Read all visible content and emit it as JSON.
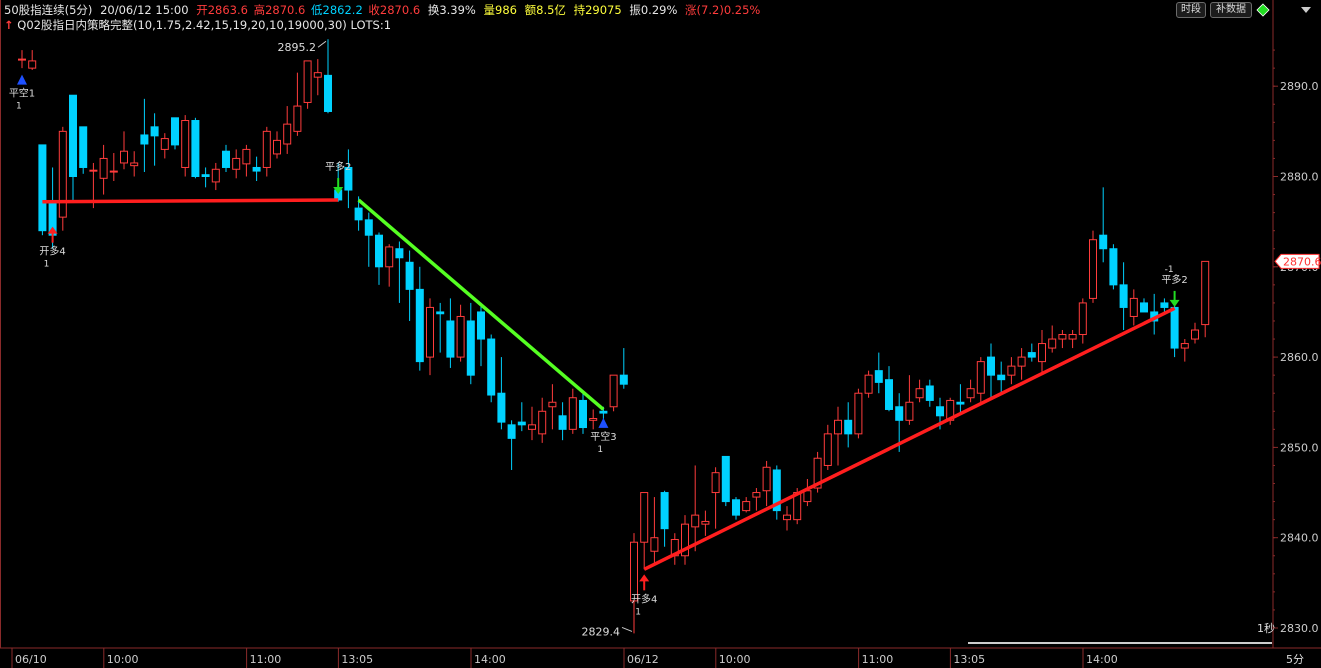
{
  "header": {
    "symbol": "50股指连续(5分)",
    "datetime": "20/06/12 15:00",
    "open_label": "开",
    "open_value": "2863.6",
    "high_label": "高",
    "high_value": "2870.6",
    "low_label": "低",
    "low_value": "2862.2",
    "close_label": "收",
    "close_value": "2870.6",
    "turnover_label": "换",
    "turnover_value": "3.39%",
    "volume_label": "量",
    "volume_value": "986",
    "amount_label": "额",
    "amount_value": "8.5亿",
    "oi_label": "持",
    "oi_value": "29075",
    "amplitude_label": "振",
    "amplitude_value": "0.29%",
    "change_label": "涨",
    "change_value": "(7.2)",
    "change_pct": "0.25%"
  },
  "strategy": {
    "arrow": "↑",
    "text": "Q02股指日内策略完整(10,1.75,2.42,15,19,20,10,19000,30) LOTS:1"
  },
  "toolbar": {
    "timeshare_label": "时段",
    "supplement_label": "补数据"
  },
  "icons": {
    "up": "triangle-up-icon",
    "down": "triangle-down-icon",
    "diamond": "diamond-icon",
    "up_arrow": "red-up-arrow-icon",
    "down_arrow": "green-down-arrow-icon"
  },
  "colors": {
    "up": "#ff3c3c",
    "down": "#00d2ff",
    "signal_red": "#ff1e1e",
    "signal_green": "#55ff22",
    "grid": "#8a2a2a",
    "axis_text": "#cccccc"
  },
  "chart_data": {
    "type": "candlestick",
    "ylim": [
      2828,
      2897
    ],
    "y_ticks": [
      2830.0,
      2840.0,
      2850.0,
      2860.0,
      2870.0,
      2880.0,
      2890.0
    ],
    "x_tick_labels": [
      "06/10",
      "10:00",
      "11:00",
      "13:05",
      "14:00",
      "06/12",
      "10:00",
      "11:00",
      "13:05",
      "14:00"
    ],
    "x_tick_index": [
      0,
      9,
      23,
      32,
      45,
      60,
      69,
      83,
      92,
      105
    ],
    "current_price": "2870.6",
    "timeframe": "5分",
    "speed": "1秒",
    "max_label": "2895.2",
    "min_label": "2829.4",
    "candles": [
      [
        2893.0,
        2894.0,
        2892.0,
        2893.0
      ],
      [
        2892.0,
        2894.0,
        2891.8,
        2892.8
      ],
      [
        2883.5,
        2883.5,
        2873.5,
        2874.0
      ],
      [
        2877.2,
        2881.0,
        2872.0,
        2873.5
      ],
      [
        2875.5,
        2885.5,
        2874.0,
        2885.0
      ],
      [
        2889.0,
        2889.0,
        2877.2,
        2880.0
      ],
      [
        2885.5,
        2885.5,
        2880.3,
        2881.0
      ],
      [
        2880.6,
        2881.5,
        2876.5,
        2880.7
      ],
      [
        2879.8,
        2883.5,
        2878.0,
        2882.0
      ],
      [
        2880.5,
        2882.6,
        2879.5,
        2880.6
      ],
      [
        2881.5,
        2885.0,
        2880.8,
        2882.8
      ],
      [
        2881.2,
        2882.8,
        2880.0,
        2881.5
      ],
      [
        2884.6,
        2888.6,
        2880.5,
        2883.6
      ],
      [
        2885.5,
        2887.0,
        2881.2,
        2884.5
      ],
      [
        2883.0,
        2884.8,
        2882.0,
        2884.2
      ],
      [
        2886.5,
        2886.5,
        2883.0,
        2883.5
      ],
      [
        2881.0,
        2886.8,
        2880.0,
        2886.2
      ],
      [
        2886.2,
        2886.5,
        2879.8,
        2880.0
      ],
      [
        2880.2,
        2881.0,
        2878.8,
        2880.0
      ],
      [
        2879.4,
        2881.5,
        2878.5,
        2880.8
      ],
      [
        2882.8,
        2883.5,
        2880.5,
        2881.0
      ],
      [
        2880.8,
        2883.0,
        2879.8,
        2882.0
      ],
      [
        2881.4,
        2883.5,
        2880.0,
        2883.0
      ],
      [
        2881.0,
        2882.2,
        2879.5,
        2880.6
      ],
      [
        2881.0,
        2885.5,
        2880.0,
        2885.0
      ],
      [
        2882.5,
        2885.0,
        2882.0,
        2884.0
      ],
      [
        2883.6,
        2887.8,
        2882.5,
        2885.8
      ],
      [
        2885.0,
        2891.5,
        2884.5,
        2887.8
      ],
      [
        2888.2,
        2892.8,
        2887.5,
        2892.8
      ],
      [
        2891.0,
        2893.0,
        2889.0,
        2891.5
      ],
      [
        2891.2,
        2895.2,
        2887.0,
        2887.2
      ],
      [
        2878.5,
        2881.5,
        2877.2,
        2877.4
      ],
      [
        2881.0,
        2883.0,
        2876.5,
        2878.5
      ],
      [
        2876.5,
        2877.8,
        2874.0,
        2875.2
      ],
      [
        2875.2,
        2876.0,
        2870.0,
        2873.5
      ],
      [
        2873.5,
        2873.8,
        2868.0,
        2870.0
      ],
      [
        2870.0,
        2872.5,
        2867.8,
        2872.2
      ],
      [
        2872.0,
        2872.8,
        2866.0,
        2871.0
      ],
      [
        2870.5,
        2871.8,
        2864.0,
        2867.5
      ],
      [
        2867.5,
        2870.0,
        2858.5,
        2859.5
      ],
      [
        2860.0,
        2866.5,
        2858.0,
        2865.5
      ],
      [
        2865.0,
        2866.0,
        2860.5,
        2864.8
      ],
      [
        2864.0,
        2866.5,
        2858.8,
        2860.0
      ],
      [
        2860.0,
        2865.8,
        2859.5,
        2864.5
      ],
      [
        2864.0,
        2866.0,
        2857.0,
        2858.0
      ],
      [
        2865.0,
        2866.0,
        2859.0,
        2862.0
      ],
      [
        2862.0,
        2862.5,
        2855.0,
        2855.8
      ],
      [
        2856.0,
        2860.0,
        2852.0,
        2852.8
      ],
      [
        2852.5,
        2853.0,
        2847.5,
        2851.0
      ],
      [
        2852.8,
        2855.0,
        2851.8,
        2852.5
      ],
      [
        2852.0,
        2854.5,
        2850.8,
        2852.5
      ],
      [
        2851.5,
        2855.5,
        2850.5,
        2854.0
      ],
      [
        2854.5,
        2857.0,
        2852.0,
        2855.0
      ],
      [
        2853.5,
        2855.0,
        2850.8,
        2852.0
      ],
      [
        2852.0,
        2856.5,
        2851.5,
        2855.5
      ],
      [
        2855.2,
        2856.0,
        2851.5,
        2852.2
      ],
      [
        2853.0,
        2854.2,
        2852.0,
        2853.2
      ],
      [
        2854.0,
        2854.5,
        2852.5,
        2853.8
      ],
      [
        2854.5,
        2858.0,
        2854.0,
        2858.0
      ],
      [
        2858.0,
        2861.0,
        2856.5,
        2857.0
      ],
      [
        2833.0,
        2840.5,
        2829.4,
        2839.5
      ],
      [
        2839.5,
        2845.0,
        2836.5,
        2845.0
      ],
      [
        2838.5,
        2844.5,
        2837.0,
        2840.0
      ],
      [
        2845.0,
        2845.2,
        2839.0,
        2841.0
      ],
      [
        2838.0,
        2840.5,
        2837.0,
        2839.8
      ],
      [
        2838.0,
        2842.5,
        2837.0,
        2841.5
      ],
      [
        2841.2,
        2848.0,
        2838.5,
        2842.5
      ],
      [
        2841.5,
        2843.0,
        2840.2,
        2841.8
      ],
      [
        2845.0,
        2847.8,
        2841.0,
        2847.2
      ],
      [
        2849.0,
        2849.0,
        2843.5,
        2844.0
      ],
      [
        2844.2,
        2844.5,
        2842.0,
        2842.5
      ],
      [
        2843.0,
        2844.5,
        2842.8,
        2844.0
      ],
      [
        2844.5,
        2845.5,
        2843.0,
        2845.0
      ],
      [
        2845.2,
        2848.5,
        2843.5,
        2847.8
      ],
      [
        2847.5,
        2848.0,
        2842.0,
        2843.0
      ],
      [
        2842.0,
        2843.5,
        2840.8,
        2842.5
      ],
      [
        2842.0,
        2845.5,
        2841.5,
        2845.0
      ],
      [
        2844.0,
        2846.5,
        2843.5,
        2845.2
      ],
      [
        2845.5,
        2849.5,
        2845.0,
        2848.8
      ],
      [
        2848.0,
        2852.5,
        2847.5,
        2851.5
      ],
      [
        2851.5,
        2854.5,
        2848.0,
        2853.0
      ],
      [
        2853.0,
        2855.0,
        2850.0,
        2851.5
      ],
      [
        2851.5,
        2856.5,
        2851.0,
        2856.0
      ],
      [
        2856.0,
        2858.5,
        2855.5,
        2858.0
      ],
      [
        2858.5,
        2860.5,
        2856.0,
        2857.2
      ],
      [
        2857.5,
        2859.0,
        2854.0,
        2854.2
      ],
      [
        2854.5,
        2856.0,
        2849.5,
        2853.0
      ],
      [
        2853.0,
        2858.0,
        2852.5,
        2855.0
      ],
      [
        2855.5,
        2857.5,
        2855.0,
        2856.5
      ],
      [
        2856.8,
        2857.5,
        2854.5,
        2855.2
      ],
      [
        2854.5,
        2855.5,
        2852.0,
        2853.5
      ],
      [
        2853.0,
        2855.5,
        2852.5,
        2855.2
      ],
      [
        2855.0,
        2857.0,
        2853.8,
        2854.8
      ],
      [
        2855.5,
        2857.5,
        2855.0,
        2856.5
      ],
      [
        2856.0,
        2860.0,
        2855.0,
        2859.5
      ],
      [
        2860.0,
        2861.5,
        2855.5,
        2858.0
      ],
      [
        2858.0,
        2859.5,
        2856.0,
        2857.5
      ],
      [
        2858.0,
        2860.0,
        2857.0,
        2859.0
      ],
      [
        2859.0,
        2861.0,
        2857.5,
        2860.0
      ],
      [
        2860.5,
        2861.5,
        2859.5,
        2860.0
      ],
      [
        2859.5,
        2863.0,
        2858.0,
        2861.5
      ],
      [
        2861.0,
        2863.5,
        2860.5,
        2862.0
      ],
      [
        2862.0,
        2863.0,
        2861.0,
        2862.5
      ],
      [
        2862.0,
        2863.0,
        2861.0,
        2862.5
      ],
      [
        2862.5,
        2866.5,
        2861.5,
        2866.0
      ],
      [
        2866.5,
        2874.0,
        2866.0,
        2873.0
      ],
      [
        2873.5,
        2878.8,
        2870.5,
        2872.0
      ],
      [
        2872.0,
        2872.5,
        2867.5,
        2868.0
      ],
      [
        2868.0,
        2870.5,
        2863.0,
        2865.5
      ],
      [
        2864.5,
        2867.5,
        2863.5,
        2866.5
      ],
      [
        2866.0,
        2866.5,
        2865.0,
        2865.0
      ],
      [
        2865.0,
        2867.0,
        2862.5,
        2864.0
      ],
      [
        2866.0,
        2866.5,
        2865.0,
        2865.5
      ],
      [
        2865.5,
        2865.8,
        2860.0,
        2861.0
      ],
      [
        2861.0,
        2862.0,
        2859.5,
        2861.5
      ],
      [
        2862.0,
        2863.8,
        2861.5,
        2863.0
      ],
      [
        2863.6,
        2870.6,
        2862.2,
        2870.6
      ]
    ],
    "trend_lines": [
      {
        "color": "red",
        "points": [
          [
            2,
            2877.2
          ],
          [
            31,
            2877.4
          ]
        ]
      },
      {
        "color": "green",
        "points": [
          [
            33,
            2877.4
          ],
          [
            57,
            2854.2
          ]
        ]
      },
      {
        "color": "red",
        "points": [
          [
            61,
            2836.5
          ],
          [
            113,
            2865.4
          ]
        ]
      }
    ],
    "signals": [
      {
        "index": 0,
        "type": "blue-up",
        "label": "平空1",
        "sub": "1",
        "price": 2890.5
      },
      {
        "index": 3,
        "type": "red-up",
        "label": "开多4",
        "sub": "1",
        "price": 2874.0
      },
      {
        "index": 31,
        "type": "green-down",
        "label": "平多2",
        "sub": "",
        "price": 2878.5
      },
      {
        "index": 57,
        "type": "blue-up",
        "label": "平空3",
        "sub": "1",
        "price": 2852.5
      },
      {
        "index": 61,
        "type": "red-up",
        "label": "开多4",
        "sub": "1",
        "price": 2835.5
      },
      {
        "index": 113,
        "type": "green-down",
        "label": "平多2",
        "sub": "-1",
        "price": 2866.0
      }
    ]
  }
}
